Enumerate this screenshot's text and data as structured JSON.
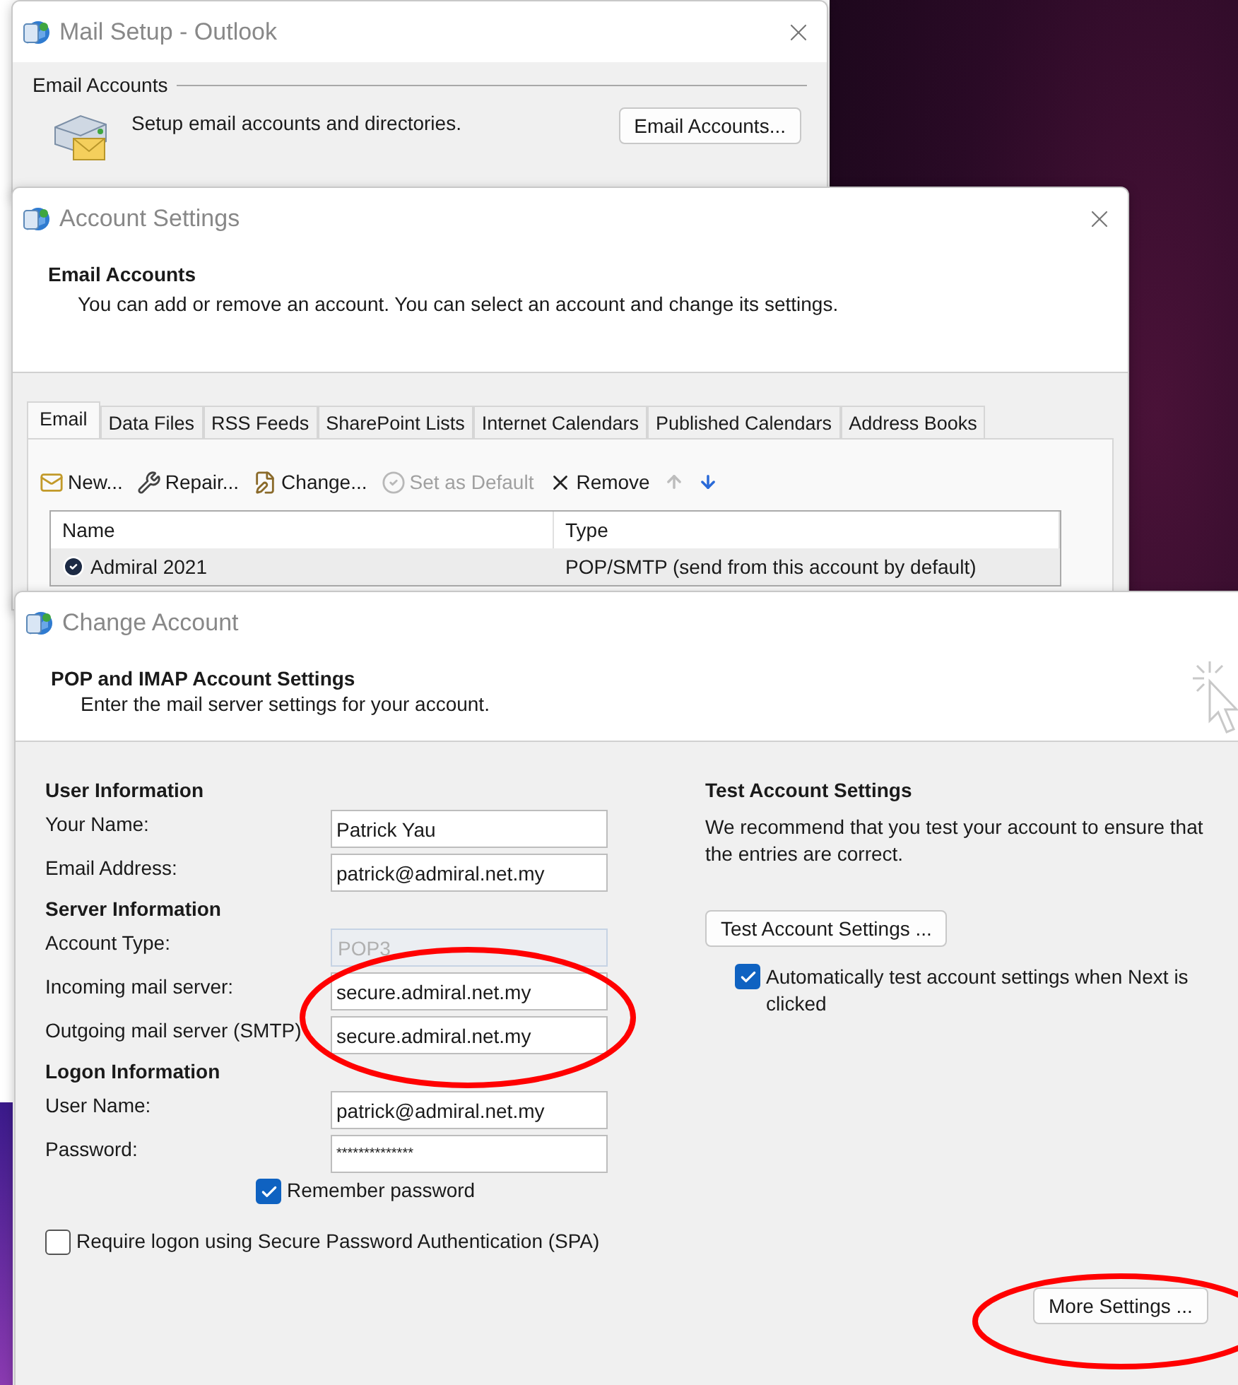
{
  "mail_setup": {
    "title": "Mail Setup - Outlook",
    "section": "Email Accounts",
    "description": "Setup email accounts and directories.",
    "button": "Email Accounts..."
  },
  "account_settings": {
    "title": "Account Settings",
    "heading": "Email Accounts",
    "description": "You can add or remove an account. You can select an account and change its settings.",
    "tabs": [
      {
        "label": "Email",
        "selected": true
      },
      {
        "label": "Data Files",
        "selected": false
      },
      {
        "label": "RSS Feeds",
        "selected": false
      },
      {
        "label": "SharePoint Lists",
        "selected": false
      },
      {
        "label": "Internet Calendars",
        "selected": false
      },
      {
        "label": "Published Calendars",
        "selected": false
      },
      {
        "label": "Address Books",
        "selected": false
      }
    ],
    "toolbar": [
      {
        "kind": "new",
        "label": "New...",
        "disabled": false
      },
      {
        "kind": "repair",
        "label": "Repair...",
        "disabled": false
      },
      {
        "kind": "change",
        "label": "Change...",
        "disabled": false
      },
      {
        "kind": "default",
        "label": "Set as Default",
        "disabled": true
      },
      {
        "kind": "remove",
        "label": "Remove",
        "disabled": false
      },
      {
        "kind": "up",
        "disabled": true
      },
      {
        "kind": "down",
        "disabled": false
      }
    ],
    "columns": [
      "Name",
      "Type"
    ],
    "rows": [
      {
        "name": "Admiral 2021",
        "type": "POP/SMTP (send from this account by default)",
        "default": true,
        "selected": true
      }
    ]
  },
  "change_account": {
    "title": "Change Account",
    "heading": "POP and IMAP Account Settings",
    "subheading": "Enter the mail server settings for your account.",
    "sections": [
      {
        "title": "User Information",
        "fields": [
          {
            "label": "Your Name:",
            "value": "Patrick Yau",
            "kind": "text"
          },
          {
            "label": "Email Address:",
            "value": "patrick@admiral.net.my",
            "kind": "text"
          }
        ]
      },
      {
        "title": "Server Information",
        "fields": [
          {
            "label": "Account Type:",
            "value": "POP3",
            "kind": "select"
          },
          {
            "label": "Incoming mail server:",
            "value": "secure.admiral.net.my",
            "kind": "text"
          },
          {
            "label": "Outgoing mail server (SMTP)",
            "value": "secure.admiral.net.my",
            "kind": "text"
          }
        ]
      },
      {
        "title": "Logon Information",
        "fields": [
          {
            "label": "User Name:",
            "value": "patrick@admiral.net.my",
            "kind": "text"
          },
          {
            "label": "Password:",
            "value": "**************",
            "kind": "password"
          }
        ]
      }
    ],
    "remember_password": {
      "label": "Remember password",
      "checked": true
    },
    "spa": {
      "label": "Require logon using Secure Password Authentication (SPA)",
      "checked": false
    },
    "test": {
      "title": "Test Account Settings",
      "description": "We recommend that you test your account to ensure that the entries are correct.",
      "button": "Test Account Settings ...",
      "auto_test": {
        "label": "Automatically test account settings when Next is clicked",
        "checked": true
      }
    },
    "more_button": "More Settings ..."
  }
}
